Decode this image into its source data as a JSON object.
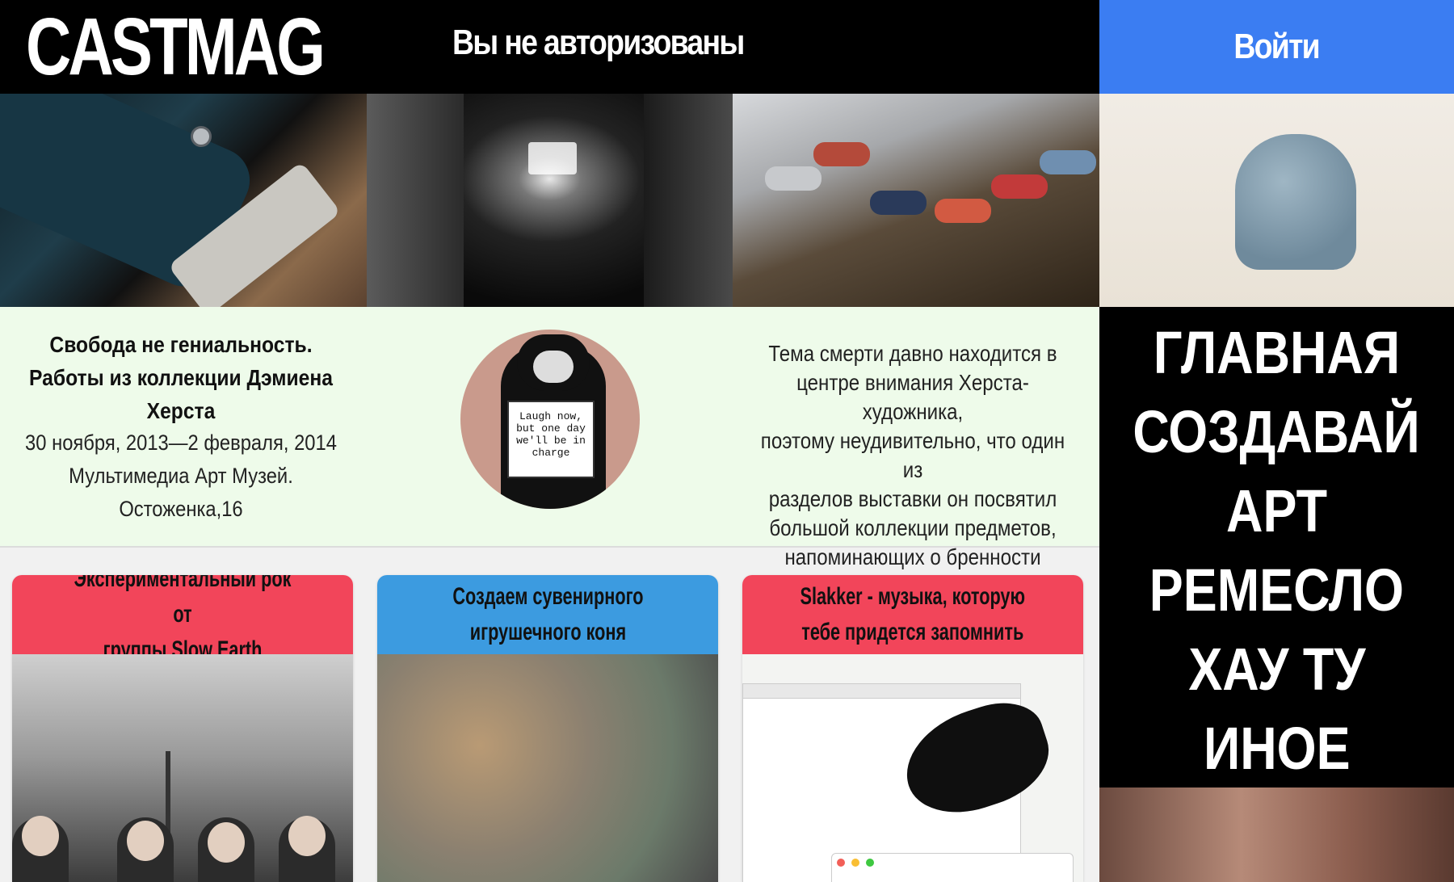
{
  "header": {
    "logo": "CASTMAG",
    "auth_status": "Вы не авторизованы",
    "login_label": "Войти"
  },
  "feature": {
    "title_lines": [
      "Свобода не гениальность.",
      "Работы из коллекции Дэмиена",
      "Херста"
    ],
    "meta_lines": [
      "30 ноября, 2013—2 февраля, 2014",
      "Мультимедиа Арт Музей.",
      "Остоженка,16"
    ],
    "sign_text": "Laugh now, but one day we'll be in charge",
    "description_lines": [
      "Тема смерти давно находится в",
      "центре внимания Херста-художника,",
      "поэтому неудивительно, что один из",
      "разделов выставки он посвятил",
      "большой коллекции предметов,",
      "напоминающих о бренности бытия."
    ]
  },
  "menu": {
    "items": [
      "ГЛАВНАЯ",
      "СОЗДАВАЙ",
      "АРТ",
      "РЕМЕСЛО",
      "ХАУ ТУ",
      "ИНОЕ"
    ]
  },
  "cards": [
    {
      "title_lines": [
        "Экспериментальный рок от",
        "группы Slow Earth"
      ],
      "color": "#f2455a"
    },
    {
      "title_lines": [
        "Создаем сувенирного",
        "игрушечного коня"
      ],
      "color": "#3c9be0"
    },
    {
      "title_lines": [
        "Slakker - музыка, которую",
        "тебе придется запомнить"
      ],
      "color": "#f2455a"
    }
  ],
  "colors": {
    "header_bg": "#000000",
    "login_bg": "#3b7df2",
    "feature_bg": "#eefbea",
    "card_red": "#f2455a",
    "card_blue": "#3c9be0"
  }
}
